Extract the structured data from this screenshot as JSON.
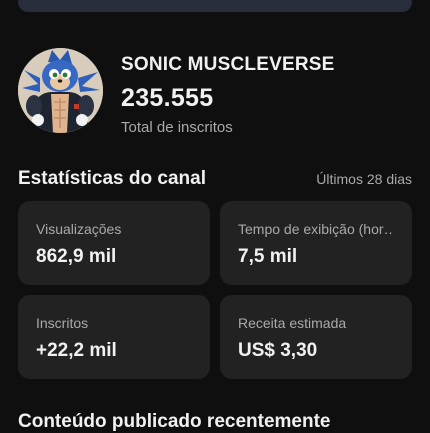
{
  "channel": {
    "name": "SONIC MUSCLEVERSE",
    "subscriber_count": "235.555",
    "subscriber_label": "Total de inscritos",
    "avatar": "channel-avatar-muscular-blue-hedgehog"
  },
  "stats": {
    "title": "Estatísticas do canal",
    "range": "Últimos 28 dias",
    "cards": [
      {
        "label": "Visualizações",
        "value": "862,9 mil"
      },
      {
        "label": "Tempo de exibição (hor…",
        "value": "7,5 mil"
      },
      {
        "label": "Inscritos",
        "value": "+22,2 mil"
      },
      {
        "label": "Receita estimada",
        "value": "US$ 3,30"
      }
    ]
  },
  "recent": {
    "title": "Conteúdo publicado recentemente"
  },
  "colors": {
    "background": "#0f0f0f",
    "card": "#222222",
    "banner": "#272d3a",
    "text_primary": "#f1f1f1",
    "text_secondary": "#aaaaaa"
  }
}
